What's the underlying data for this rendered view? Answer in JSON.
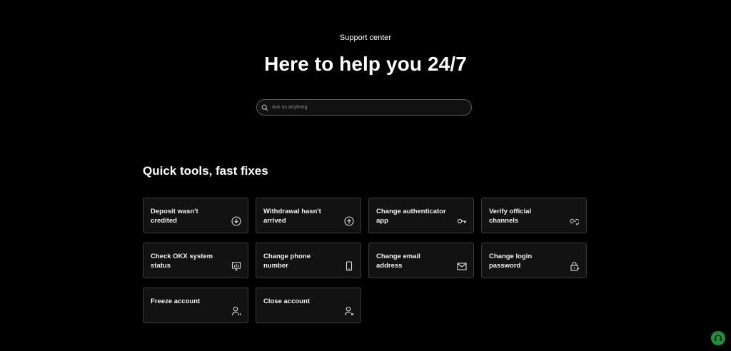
{
  "header": {
    "eyebrow": "Support center",
    "title": "Here to help you 24/7"
  },
  "search": {
    "placeholder": "Ask us anything",
    "icon": "search-icon"
  },
  "quick_tools": {
    "title": "Quick tools, fast fixes",
    "items": [
      {
        "label": "Deposit wasn't credited",
        "icon": "deposit-icon"
      },
      {
        "label": "Withdrawal hasn't arrived",
        "icon": "withdrawal-icon"
      },
      {
        "label": "Change authenticator app",
        "icon": "key-icon"
      },
      {
        "label": "Verify official channels",
        "icon": "link-check-icon"
      },
      {
        "label": "Check OKX system status",
        "icon": "system-status-icon"
      },
      {
        "label": "Change phone number",
        "icon": "phone-icon"
      },
      {
        "label": "Change email address",
        "icon": "mail-icon"
      },
      {
        "label": "Change login password",
        "icon": "lock-icon"
      },
      {
        "label": "Freeze account",
        "icon": "freeze-user-icon"
      },
      {
        "label": "Close account",
        "icon": "close-user-icon"
      }
    ]
  },
  "help_button": {
    "icon": "headset-icon",
    "color": "#1f8f3a"
  }
}
